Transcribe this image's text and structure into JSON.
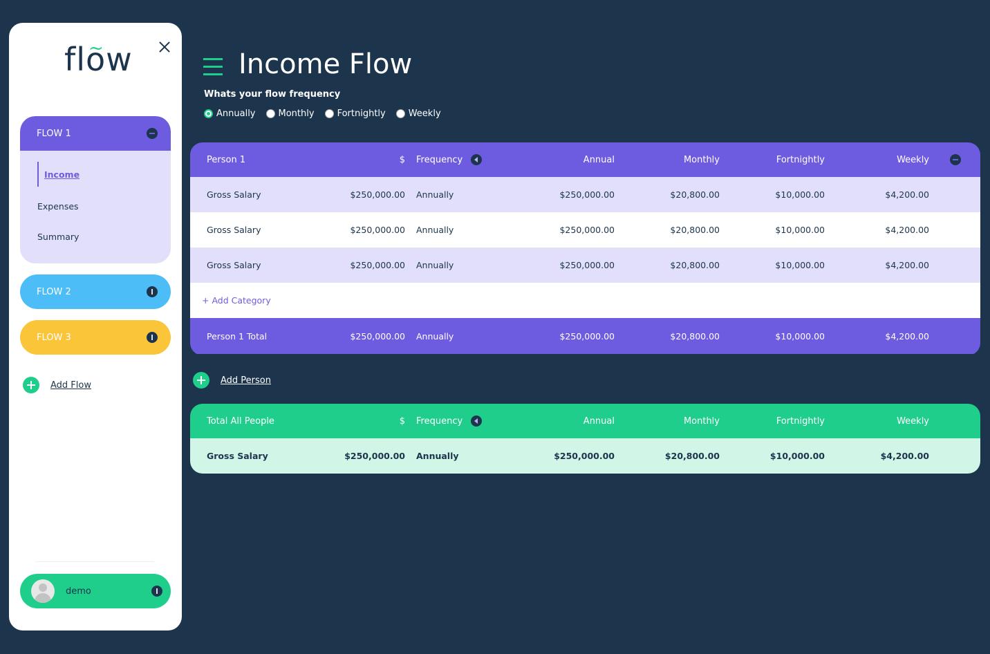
{
  "sidebar": {
    "logo": "flow",
    "flows": [
      {
        "label": "FLOW 1",
        "color": "#6e5ce0",
        "expanded": true,
        "items": [
          "Income",
          "Expenses",
          "Summary"
        ],
        "active_item": "Income"
      },
      {
        "label": "FLOW 2",
        "color": "#4cbdf6"
      },
      {
        "label": "FLOW 3",
        "color": "#fbc53a"
      }
    ],
    "add_flow": "Add Flow",
    "user": {
      "name": "demo"
    }
  },
  "page": {
    "title": "Income Flow",
    "frequency_question": "Whats your flow frequency",
    "frequency_options": [
      "Annually",
      "Monthly",
      "Fortnightly",
      "Weekly"
    ],
    "frequency_selected": "Annually"
  },
  "person_table": {
    "headers": {
      "name": "Person 1",
      "amount": "$",
      "frequency": "Frequency",
      "annual": "Annual",
      "monthly": "Monthly",
      "fortnightly": "Fortnightly",
      "weekly": "Weekly"
    },
    "rows": [
      {
        "name": "Gross Salary",
        "amount": "$250,000.00",
        "frequency": "Annually",
        "annual": "$250,000.00",
        "monthly": "$20,800.00",
        "fortnightly": "$10,000.00",
        "weekly": "$4,200.00"
      },
      {
        "name": "Gross Salary",
        "amount": "$250,000.00",
        "frequency": "Annually",
        "annual": "$250,000.00",
        "monthly": "$20,800.00",
        "fortnightly": "$10,000.00",
        "weekly": "$4,200.00"
      },
      {
        "name": "Gross Salary",
        "amount": "$250,000.00",
        "frequency": "Annually",
        "annual": "$250,000.00",
        "monthly": "$20,800.00",
        "fortnightly": "$10,000.00",
        "weekly": "$4,200.00"
      }
    ],
    "add_category": "+ Add Category",
    "total": {
      "name": "Person 1 Total",
      "amount": "$250,000.00",
      "frequency": "Annually",
      "annual": "$250,000.00",
      "monthly": "$20,800.00",
      "fortnightly": "$10,000.00",
      "weekly": "$4,200.00"
    }
  },
  "add_person": "Add Person",
  "total_table": {
    "headers": {
      "name": "Total All People",
      "amount": "$",
      "frequency": "Frequency",
      "annual": "Annual",
      "monthly": "Monthly",
      "fortnightly": "Fortnightly",
      "weekly": "Weekly"
    },
    "row": {
      "name": "Gross Salary",
      "amount": "$250,000.00",
      "frequency": "Annually",
      "annual": "$250,000.00",
      "monthly": "$20,800.00",
      "fortnightly": "$10,000.00",
      "weekly": "$4,200.00"
    }
  },
  "colors": {
    "background": "#1c344c",
    "accent_purple": "#6e5ce0",
    "accent_green": "#20ce8c",
    "accent_blue": "#4cbdf6",
    "accent_yellow": "#fbc53a"
  },
  "icons": [
    "close-icon",
    "hamburger-icon",
    "collapse-icon",
    "expand-icon",
    "add-icon",
    "avatar-icon",
    "sort-icon"
  ]
}
